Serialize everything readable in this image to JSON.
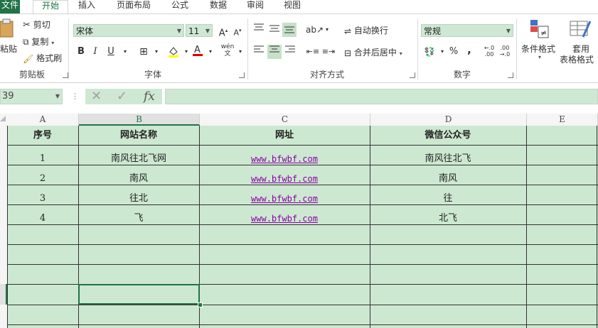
{
  "tabs": [
    {
      "id": "file",
      "label": "文件"
    },
    {
      "id": "home",
      "label": "开始"
    },
    {
      "id": "insert",
      "label": "插入"
    },
    {
      "id": "layout",
      "label": "页面布局"
    },
    {
      "id": "formula",
      "label": "公式"
    },
    {
      "id": "data",
      "label": "数据"
    },
    {
      "id": "review",
      "label": "审阅"
    },
    {
      "id": "view",
      "label": "视图"
    }
  ],
  "ribbon": {
    "clipboard": {
      "paste": "粘贴",
      "cut": "剪切",
      "copy": "复制",
      "format_painter": "格式刷",
      "label": "剪贴板"
    },
    "font": {
      "name": "宋体",
      "size": "11",
      "bold": "B",
      "italic": "I",
      "underline": "U",
      "label": "字体",
      "phonetic": "wén"
    },
    "alignment": {
      "wrap": "自动换行",
      "merge": "合并后居中",
      "label": "对齐方式"
    },
    "number": {
      "format": "常规",
      "percent": "%",
      "comma": ",",
      "inc_decimal": ".00",
      "dec_decimal": ".00",
      "label": "数字"
    },
    "styles": {
      "conditional": "条件格式",
      "table_line1": "套用",
      "table_line2": "表格格式"
    }
  },
  "formula_bar": {
    "name_box": "39",
    "fx": "fx",
    "value": ""
  },
  "columns": [
    "A",
    "B",
    "C",
    "D",
    "E"
  ],
  "selected_column": "B",
  "table": {
    "headers": [
      "序号",
      "网站名称",
      "网址",
      "微信公众号"
    ],
    "rows": [
      [
        "1",
        "南风往北飞网",
        "www.bfwbf.com",
        "南风往北飞"
      ],
      [
        "2",
        "南风",
        "www.bfwbf.com",
        "南风"
      ],
      [
        "3",
        "往北",
        "www.bfwbf.com",
        "往"
      ],
      [
        "4",
        "飞",
        "www.bfwbf.com",
        "北飞"
      ]
    ]
  },
  "colors": {
    "accent": "#217346",
    "cell_bg": "#cde8d1",
    "link": "#8b00a8"
  }
}
